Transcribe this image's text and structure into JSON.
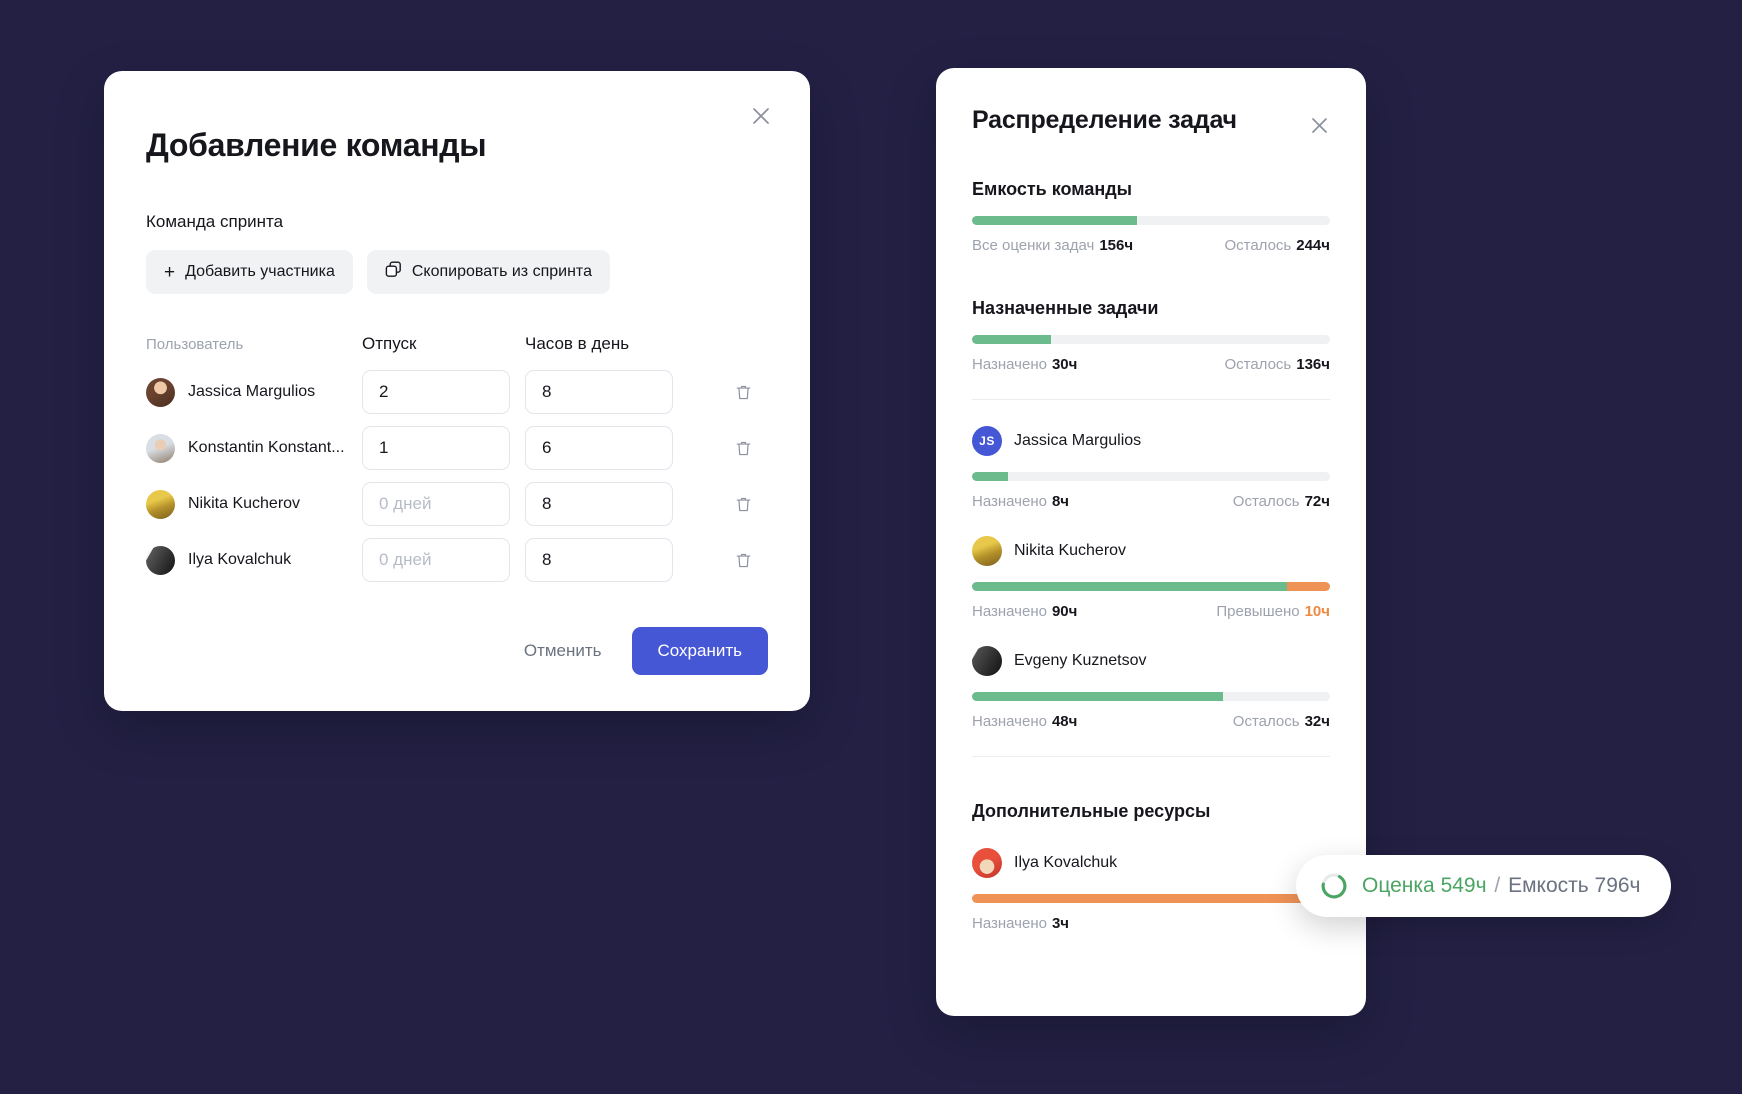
{
  "colors": {
    "background": "#232044",
    "primary": "#4657d6",
    "green": "#6cbb8c",
    "orange": "#ef9256",
    "track": "#f0f1f3",
    "muted": "#9da2ae"
  },
  "modal": {
    "title": "Добавление команды",
    "close_icon": "close-icon",
    "section_label": "Команда спринта",
    "add_member_button": "Добавить участника",
    "copy_from_sprint_button": "Скопировать из спринта",
    "columns": {
      "user": "Пользователь",
      "vacation": "Отпуск",
      "hours_per_day": "Часов в день"
    },
    "vacation_placeholder": "0 дней",
    "rows": [
      {
        "name": "Jassica Margulios",
        "avatar": "av-jassica",
        "vacation": "2",
        "hours": "8"
      },
      {
        "name": "Konstantin Konstant...",
        "avatar": "av-konst",
        "vacation": "1",
        "hours": "6"
      },
      {
        "name": "Nikita Kucherov",
        "avatar": "av-nikita",
        "vacation": "",
        "hours": "8"
      },
      {
        "name": "Ilya Kovalchuk",
        "avatar": "av-ilya-d",
        "vacation": "",
        "hours": "8"
      }
    ],
    "cancel_button": "Отменить",
    "save_button": "Сохранить",
    "delete_icon": "trash-icon"
  },
  "panel": {
    "title": "Распределение задач",
    "close_icon": "close-icon",
    "capacity": {
      "heading": "Емкость команды",
      "fill_percent": 46,
      "over_percent": 0,
      "left_label": "Все оценки задач",
      "left_value": "156ч",
      "right_label": "Осталось",
      "right_value": "244ч"
    },
    "assigned": {
      "heading": "Назначенные задачи",
      "fill_percent": 22,
      "over_percent": 0,
      "left_label": "Назначено",
      "left_value": "30ч",
      "right_label": "Осталось",
      "right_value": "136ч"
    },
    "members": [
      {
        "name": "Jassica Margulios",
        "avatar_type": "initials",
        "initials": "JS",
        "fill_percent": 10,
        "over_percent": 0,
        "left_label": "Назначено",
        "left_value": "8ч",
        "right_label": "Осталось",
        "right_value": "72ч",
        "right_is_over": false
      },
      {
        "name": "Nikita Kucherov",
        "avatar_type": "photo",
        "avatar": "av-nikita",
        "fill_percent": 88,
        "over_percent": 12,
        "left_label": "Назначено",
        "left_value": "90ч",
        "right_label": "Превышено",
        "right_value": "10ч",
        "right_is_over": true
      },
      {
        "name": "Evgeny Kuznetsov",
        "avatar_type": "photo",
        "avatar": "av-evgeny",
        "fill_percent": 70,
        "over_percent": 0,
        "left_label": "Назначено",
        "left_value": "48ч",
        "right_label": "Осталось",
        "right_value": "32ч",
        "right_is_over": false
      }
    ],
    "extra": {
      "heading": "Дополнительные ресурсы",
      "member": {
        "name": "Ilya Kovalchuk",
        "avatar_type": "photo",
        "avatar": "av-ilya-r",
        "fill_percent": 0,
        "over_percent": 100,
        "left_label": "Назначено",
        "left_value": "3ч",
        "right_label": "",
        "right_value": "",
        "right_is_over": false
      }
    }
  },
  "toast": {
    "icon": "progress-ring-icon",
    "estimate_text": "Оценка 549ч",
    "separator": "/",
    "capacity_text": "Емкость 796ч",
    "ring_percent": 69
  }
}
